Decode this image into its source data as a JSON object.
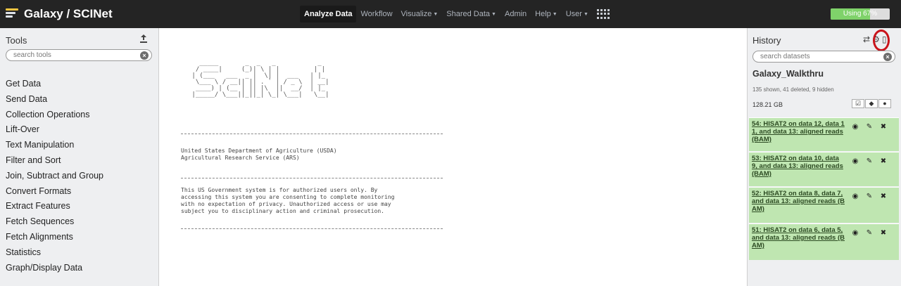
{
  "masthead": {
    "brand": "Galaxy / SCINet",
    "nav": [
      {
        "label": "Analyze Data",
        "dropdown": false,
        "active": true
      },
      {
        "label": "Workflow",
        "dropdown": false,
        "active": false
      },
      {
        "label": "Visualize",
        "dropdown": true,
        "active": false
      },
      {
        "label": "Shared Data",
        "dropdown": true,
        "active": false
      },
      {
        "label": "Admin",
        "dropdown": false,
        "active": false
      },
      {
        "label": "Help",
        "dropdown": true,
        "active": false
      },
      {
        "label": "User",
        "dropdown": true,
        "active": false
      }
    ],
    "quota_label": "Using 67%",
    "quota_percent": 67
  },
  "tools": {
    "title": "Tools",
    "search_placeholder": "search tools",
    "items": [
      "Get Data",
      "Send Data",
      "Collection Operations",
      "Lift-Over",
      "Text Manipulation",
      "Filter and Sort",
      "Join, Subtract and Group",
      "Convert Formats",
      "Extract Features",
      "Fetch Sequences",
      "Fetch Alignments",
      "Statistics",
      "Graph/Display Data"
    ]
  },
  "center": {
    "banner_art": "   _____       _  _   _           _\n  / ____|     (_)| \\ | |         | |\n | (___   ___  _ |  \\| |  ___   | |_\n  \\___ \\ / __|| || . ` | / _ \\  | __|\n  ____) | (__ | || |\\  ||  __/  | |_\n |_____/ \\___||_||_| \\_| \\___|   \\__|",
    "org_lines": "United States Department of Agriculture (USDA)\nAgricultural Research Service (ARS)",
    "notice": "This US Government system is for authorized users only. By\naccessing this system you are consenting to complete monitoring\nwith no expectation of privacy. Unauthorized access or use may\nsubject you to disciplinary action and criminal prosecution."
  },
  "history": {
    "title": "History",
    "search_placeholder": "search datasets",
    "name": "Galaxy_Walkthru",
    "counts": "135 shown, 41 deleted, 9 hidden",
    "size": "128.21 GB",
    "datasets": [
      {
        "label": "54: HISAT2 on data 12, data 11, and data 13: aligned reads (BAM)"
      },
      {
        "label": "53: HISAT2 on data 10, data 9, and data 13: aligned reads (BAM)"
      },
      {
        "label": "52: HISAT2 on data 8, data 7, and data 13: aligned reads (BAM)"
      },
      {
        "label": "51: HISAT2 on data 6, data 5, and data 13: aligned reads (BAM)"
      }
    ]
  },
  "colors": {
    "masthead_bg": "#242424",
    "quota_fill": "#7fd26a",
    "dataset_ok": "#bfe6b1",
    "highlight_ring": "#c9141b"
  },
  "icons": {
    "upload": "upload-icon",
    "clear": "clear-search-icon",
    "history_switch": "switch-history-icon",
    "history_options": "gear-icon",
    "history_columns": "columns-icon",
    "dataset_view": "eye-icon",
    "dataset_edit": "pencil-icon",
    "dataset_delete": "delete-x-icon"
  }
}
